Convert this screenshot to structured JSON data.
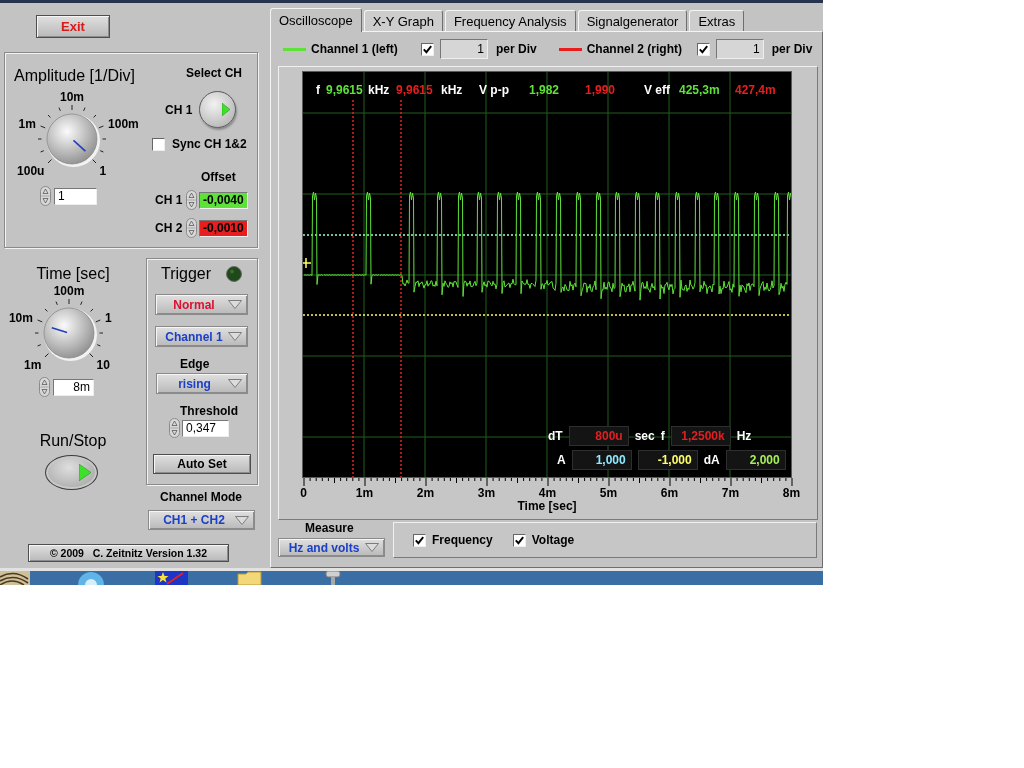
{
  "exit_button": {
    "label": "Exit"
  },
  "amplitude": {
    "title": "Amplitude [1/Div]",
    "scale_labels": [
      "100u",
      "1m",
      "10m",
      "100m",
      "1"
    ],
    "value": "1"
  },
  "channel_select": {
    "title": "Select CH",
    "label": "CH 1"
  },
  "sync": {
    "label": "Sync CH 1&2",
    "checked": false
  },
  "offset": {
    "title": "Offset",
    "channels": [
      {
        "label": "CH 1",
        "value": "-0,0040"
      },
      {
        "label": "CH 2",
        "value": "-0,0010"
      }
    ]
  },
  "time": {
    "title": "Time [sec]",
    "scale_labels": [
      "1m",
      "10m",
      "100m",
      "1",
      "10"
    ],
    "value": "8m"
  },
  "run_stop": {
    "title": "Run/Stop"
  },
  "trigger": {
    "title": "Trigger",
    "lamp_on": false,
    "mode": "Normal",
    "source": "Channel 1",
    "edge_label": "Edge",
    "edge": "rising",
    "threshold_label": "Threshold",
    "threshold": "0,347",
    "auto_set": "Auto Set"
  },
  "channel_mode": {
    "label": "Channel Mode",
    "value": "CH1 + CH2"
  },
  "copyright": "© 2009   C. Zeitnitz Version 1.32",
  "tabs": [
    {
      "label": "Oscilloscope",
      "selected": true
    },
    {
      "label": "X-Y Graph",
      "selected": false
    },
    {
      "label": "Frequency Analysis",
      "selected": false
    },
    {
      "label": "Signalgenerator",
      "selected": false
    },
    {
      "label": "Extras",
      "selected": false
    }
  ],
  "channels": [
    {
      "name": "Channel 1 (left)",
      "color": "#5ee23a",
      "checked": true,
      "scale": "1",
      "unit": "per Div"
    },
    {
      "name": "Channel 2 (right)",
      "color": "#e81e1e",
      "checked": true,
      "scale": "1",
      "unit": "per Div"
    }
  ],
  "scope": {
    "readouts": [
      {
        "label": "f",
        "values": [
          {
            "text": "9,9615",
            "unit": "kHz"
          },
          {
            "text": "9,9615",
            "unit": "kHz"
          }
        ]
      },
      {
        "label": "V p-p",
        "values": [
          {
            "text": "1,982"
          },
          {
            "text": "1,990"
          }
        ]
      },
      {
        "label": "V eff",
        "values": [
          {
            "text": "425,3m"
          },
          {
            "text": "427,4m"
          }
        ]
      }
    ],
    "cursor_rows": [
      {
        "items": [
          {
            "kind": "label",
            "text": "dT"
          },
          {
            "kind": "value",
            "text": "800u",
            "color": "#e02020"
          },
          {
            "kind": "label",
            "text": "sec"
          },
          {
            "kind": "label",
            "text": "f"
          },
          {
            "kind": "value",
            "text": "1,2500k",
            "color": "#e02020"
          },
          {
            "kind": "label",
            "text": "Hz"
          }
        ]
      },
      {
        "items": [
          {
            "kind": "label",
            "text": "A"
          },
          {
            "kind": "value",
            "text": "1,000",
            "color": "#8ee8ff"
          },
          {
            "kind": "value",
            "text": "-1,000",
            "color": "#ffff66"
          },
          {
            "kind": "label",
            "text": "dA"
          },
          {
            "kind": "value",
            "text": "2,000",
            "color": "#a6ee5a"
          }
        ]
      }
    ],
    "x_ticks": [
      "0",
      "1m",
      "2m",
      "3m",
      "4m",
      "5m",
      "6m",
      "7m",
      "8m"
    ],
    "x_label": "Time [sec]"
  },
  "measure": {
    "label": "Measure",
    "value": "Hz and volts"
  },
  "options": [
    {
      "label": "Frequency",
      "checked": true
    },
    {
      "label": "Voltage",
      "checked": true
    }
  ]
}
